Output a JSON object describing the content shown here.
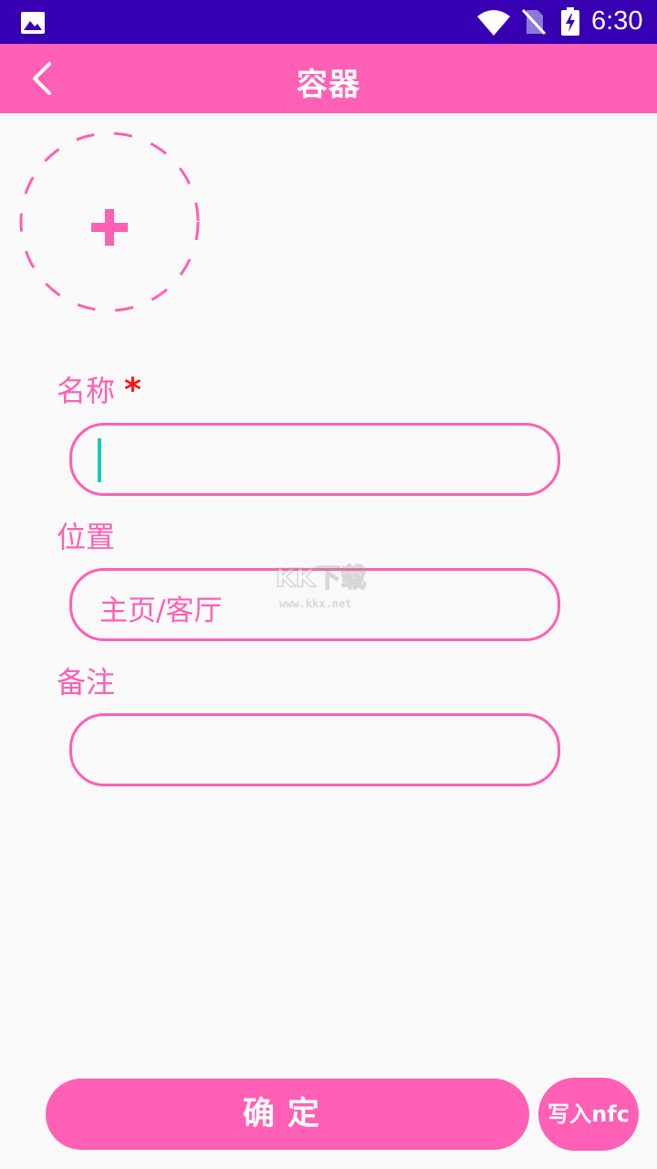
{
  "status_bar": {
    "time": "6:30",
    "icons": [
      "gallery-icon",
      "wifi-icon",
      "no-sim-icon",
      "battery-charging-icon"
    ]
  },
  "app_bar": {
    "title": "容器",
    "back_icon": "chevron-left-icon"
  },
  "avatar_picker": {
    "icon": "plus-icon"
  },
  "form": {
    "name_label": "名称",
    "required_mark": "*",
    "name_value": "",
    "location_label": "位置",
    "location_value": "主页/客厅",
    "note_label": "备注",
    "note_value": ""
  },
  "watermark": {
    "text": "KK下载",
    "url": "www.kkx.net"
  },
  "actions": {
    "confirm_label": "确定",
    "nfc_label": "写入nfc"
  },
  "colors": {
    "status_bar": "#3700b3",
    "accent": "#ff5fb4",
    "required": "#ff1010",
    "caret": "#16c9c3",
    "background": "#f9f9fa"
  }
}
